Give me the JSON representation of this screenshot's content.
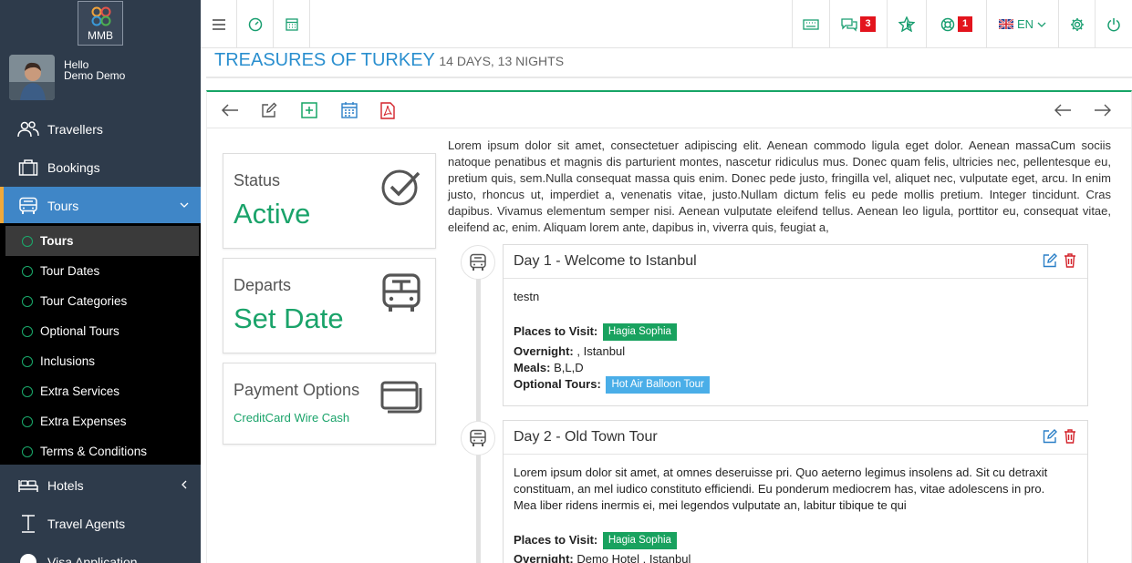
{
  "sidebar": {
    "logo_text": "MMB",
    "greeting": "Hello",
    "user_name": "Demo Demo",
    "items": [
      {
        "label": "Travellers",
        "icon": "users-icon"
      },
      {
        "label": "Bookings",
        "icon": "briefcase-icon"
      },
      {
        "label": "Tours",
        "icon": "bus-icon"
      },
      {
        "label": "Hotels",
        "icon": "bed-icon"
      },
      {
        "label": "Travel Agents",
        "icon": "agent-icon"
      },
      {
        "label": "Visa Application",
        "icon": "globe-icon"
      }
    ],
    "submenu": [
      {
        "label": "Tours"
      },
      {
        "label": "Tour Dates"
      },
      {
        "label": "Tour Categories"
      },
      {
        "label": "Optional Tours"
      },
      {
        "label": "Inclusions"
      },
      {
        "label": "Extra Services"
      },
      {
        "label": "Extra Expenses"
      },
      {
        "label": "Terms & Conditions"
      }
    ]
  },
  "topbar": {
    "messages_count": "3",
    "support_count": "1",
    "language": "EN"
  },
  "page": {
    "title": "TREASURES OF TURKEY",
    "subtitle": "14 DAYS, 13 NIGHTS"
  },
  "summary": {
    "status_label": "Status",
    "status_value": "Active",
    "departs_label": "Departs",
    "departs_value": "Set Date",
    "payment_label": "Payment Options",
    "payment_value": "CreditCard Wire Cash"
  },
  "description": "Lorem ipsum dolor sit amet, consectetuer adipiscing elit. Aenean commodo ligula eget dolor. Aenean massaCum sociis natoque penatibus et magnis dis parturient montes, nascetur ridiculus mus. Donec quam felis, ultricies nec, pellentesque eu, pretium quis, sem.Nulla consequat massa quis enim. Donec pede justo, fringilla vel, aliquet nec, vulputate eget, arcu. In enim justo, rhoncus ut, imperdiet a, venenatis vitae, justo.Nullam dictum felis eu pede mollis pretium. Integer tincidunt. Cras dapibus. Vivamus elementum semper nisi. Aenean vulputate eleifend tellus. Aenean leo ligula, porttitor eu, consequat vitae, eleifend ac, enim. Aliquam lorem ante, dapibus in, viverra quis, feugiat a,",
  "labels": {
    "places": "Places to Visit:",
    "overnight": "Overnight:",
    "meals": "Meals:",
    "optional": "Optional Tours:"
  },
  "days": [
    {
      "title": "Day 1 - Welcome to Istanbul",
      "text": "testn",
      "place": "Hagia Sophia",
      "overnight": ", Istanbul",
      "meals": "B,L,D",
      "optional_tour": "Hot Air Balloon Tour"
    },
    {
      "title": "Day 2 - Old Town Tour",
      "text1": "Lorem ipsum dolor sit amet, at omnes deseruisse pri. Quo aeterno legimus insolens ad. Sit cu detraxit",
      "text2": "constituam, an mel iudico constituto efficiendi. Eu ponderum mediocrem has, vitae adolescens in pro.",
      "text3": "Mea liber ridens inermis ei, mei legendos vulputate an, labitur tibique te qui",
      "place": "Hagia Sophia",
      "overnight": "Demo Hotel , Istanbul"
    }
  ],
  "colors": {
    "sidebar_bg": "#2e3b4b",
    "active_blue": "#3f86c7",
    "accent_green": "#17a566",
    "title_blue": "#2a8fcf",
    "badge_red": "#e3141d"
  }
}
